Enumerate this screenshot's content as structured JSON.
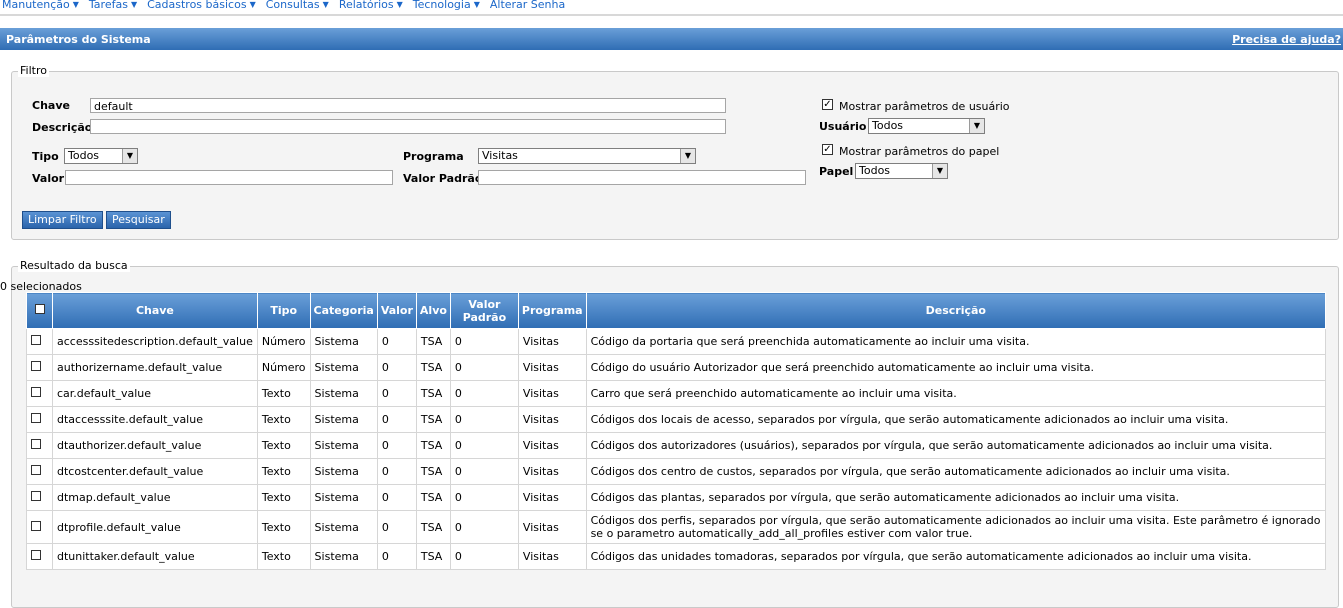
{
  "menu": {
    "items": [
      "Manutenção",
      "Tarefas",
      "Cadastros básicos",
      "Consultas",
      "Relatórios",
      "Tecnologia",
      "Alterar Senha"
    ]
  },
  "titlebar": {
    "title": "Parâmetros do Sistema",
    "help": "Precisa de ajuda?"
  },
  "filter": {
    "legend": "Filtro",
    "chave_label": "Chave",
    "chave_value": "default",
    "descricao_label": "Descrição",
    "descricao_value": "",
    "tipo_label": "Tipo",
    "tipo_value": "Todos",
    "programa_label": "Programa",
    "programa_value": "Visitas",
    "valor_label": "Valor",
    "valor_value": "",
    "valor_padrao_label": "Valor Padrão",
    "valor_padrao_value": "",
    "mostrar_usuario_label": "Mostrar parâmetros de usuário",
    "usuario_label": "Usuário",
    "usuario_value": "Todos",
    "mostrar_papel_label": "Mostrar parâmetros do papel",
    "papel_label": "Papel",
    "papel_value": "Todos",
    "limpar_label": "Limpar Filtro",
    "pesquisar_label": "Pesquisar"
  },
  "results": {
    "legend": "Resultado da busca",
    "selected_count": "0 selecionados",
    "columns": [
      "Chave",
      "Tipo",
      "Categoria",
      "Valor",
      "Alvo",
      "Valor Padrão",
      "Programa",
      "Descrição"
    ],
    "rows": [
      {
        "chave": "accesssitedescription.default_value",
        "tipo": "Número",
        "categoria": "Sistema",
        "valor": "0",
        "alvo": "TSA",
        "padrao": "0",
        "programa": "Visitas",
        "descricao": "Código da portaria que será preenchida automaticamente ao incluir uma visita."
      },
      {
        "chave": "authorizername.default_value",
        "tipo": "Número",
        "categoria": "Sistema",
        "valor": "0",
        "alvo": "TSA",
        "padrao": "0",
        "programa": "Visitas",
        "descricao": "Código do usuário Autorizador que será preenchido automaticamente ao incluir uma visita."
      },
      {
        "chave": "car.default_value",
        "tipo": "Texto",
        "categoria": "Sistema",
        "valor": "0",
        "alvo": "TSA",
        "padrao": "0",
        "programa": "Visitas",
        "descricao": "Carro que será preenchido automaticamente ao incluir uma visita."
      },
      {
        "chave": "dtaccesssite.default_value",
        "tipo": "Texto",
        "categoria": "Sistema",
        "valor": "0",
        "alvo": "TSA",
        "padrao": "0",
        "programa": "Visitas",
        "descricao": "Códigos dos locais de acesso, separados por vírgula, que serão automaticamente adicionados ao incluir uma visita."
      },
      {
        "chave": "dtauthorizer.default_value",
        "tipo": "Texto",
        "categoria": "Sistema",
        "valor": "0",
        "alvo": "TSA",
        "padrao": "0",
        "programa": "Visitas",
        "descricao": "Códigos dos autorizadores (usuários), separados por vírgula, que serão automaticamente adicionados ao incluir uma visita."
      },
      {
        "chave": "dtcostcenter.default_value",
        "tipo": "Texto",
        "categoria": "Sistema",
        "valor": "0",
        "alvo": "TSA",
        "padrao": "0",
        "programa": "Visitas",
        "descricao": "Códigos dos centro de custos, separados por vírgula, que serão automaticamente adicionados ao incluir uma visita."
      },
      {
        "chave": "dtmap.default_value",
        "tipo": "Texto",
        "categoria": "Sistema",
        "valor": "0",
        "alvo": "TSA",
        "padrao": "0",
        "programa": "Visitas",
        "descricao": "Códigos das plantas, separados por vírgula, que serão automaticamente adicionados ao incluir uma visita."
      },
      {
        "chave": "dtprofile.default_value",
        "tipo": "Texto",
        "categoria": "Sistema",
        "valor": "0",
        "alvo": "TSA",
        "padrao": "0",
        "programa": "Visitas",
        "descricao": "Códigos dos perfis, separados por vírgula, que serão automaticamente adicionados ao incluir uma visita. Este parâmetro é ignorado se o parametro automatically_add_all_profiles estiver com valor true."
      },
      {
        "chave": "dtunittaker.default_value",
        "tipo": "Texto",
        "categoria": "Sistema",
        "valor": "0",
        "alvo": "TSA",
        "padrao": "0",
        "programa": "Visitas",
        "descricao": "Códigos das unidades tomadoras, separados por vírgula, que serão automaticamente adicionados ao incluir uma visita."
      }
    ]
  }
}
